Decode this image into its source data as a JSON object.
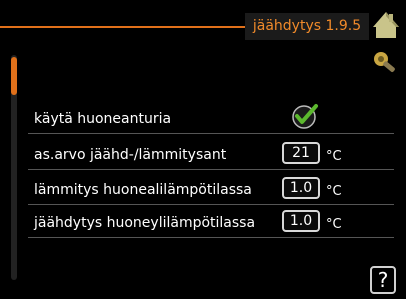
{
  "header": {
    "title": "jäähdytys 1.9.5"
  },
  "icons": {
    "house": "house-icon",
    "tool": "service-tool-icon",
    "check": "checkmark-icon",
    "help": "help-icon"
  },
  "colors": {
    "accent": "#e0701a",
    "title_text": "#f08a2a",
    "check_green": "#5cb82e"
  },
  "scrollbar": {
    "position_fraction": 0.0
  },
  "rows": [
    {
      "label": "käytä huoneanturia",
      "checked": true
    },
    {
      "label": "as.arvo jäähd-/lämmitysant",
      "value": "21",
      "unit": "°C"
    },
    {
      "label": "lämmitys huonealilämpötilassa",
      "value": "1.0",
      "unit": "°C"
    },
    {
      "label": "jäähdytys huoneylilämpötilassa",
      "value": "1.0",
      "unit": "°C"
    }
  ],
  "help": {
    "label": "?"
  }
}
